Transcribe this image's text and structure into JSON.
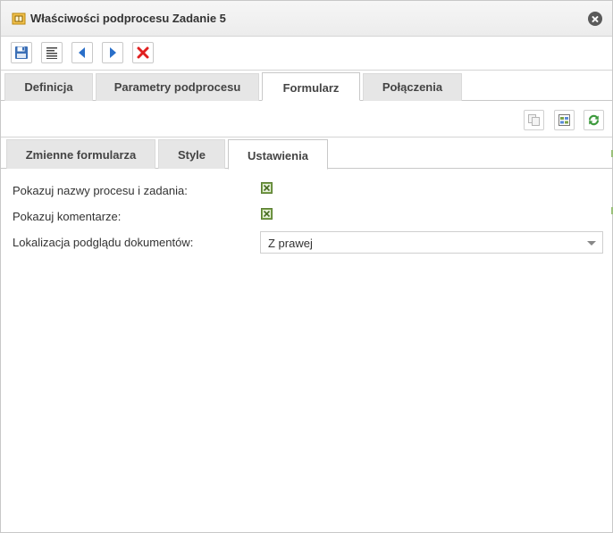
{
  "window": {
    "title": "Właściwości podprocesu Zadanie 5"
  },
  "icons": {
    "title": "subprocess-icon",
    "close": "close-icon",
    "toolbar": [
      "save-icon",
      "properties-icon",
      "arrow-left-icon",
      "arrow-right-icon",
      "delete-icon"
    ],
    "subtoolbar": [
      "copy-icon",
      "form-layout-icon",
      "refresh-icon"
    ]
  },
  "main_tabs": [
    {
      "label": "Definicja",
      "active": false
    },
    {
      "label": "Parametry podprocesu",
      "active": false
    },
    {
      "label": "Formularz",
      "active": true
    },
    {
      "label": "Połączenia",
      "active": false
    }
  ],
  "form_tabs": [
    {
      "label": "Zmienne formularza",
      "active": false
    },
    {
      "label": "Style",
      "active": false
    },
    {
      "label": "Ustawienia",
      "active": true
    }
  ],
  "settings": {
    "show_names_label": "Pokazuj nazwy procesu i zadania:",
    "show_names_checked": true,
    "show_comments_label": "Pokazuj komentarze:",
    "show_comments_checked": true,
    "doc_preview_label": "Lokalizacja podglądu dokumentów:",
    "doc_preview_value": "Z prawej"
  },
  "colors": {
    "accent_green": "#7aa24a",
    "delete_red": "#e02020",
    "arrow_blue": "#2a6fc9",
    "tab_inactive": "#e6e6e6"
  }
}
